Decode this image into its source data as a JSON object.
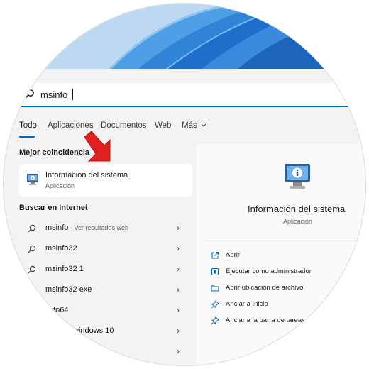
{
  "search": {
    "value": "msinfo"
  },
  "tabs": [
    {
      "label": "Todo"
    },
    {
      "label": "Aplicaciones"
    },
    {
      "label": "Documentos"
    },
    {
      "label": "Web"
    },
    {
      "label": "Más"
    }
  ],
  "best_match": {
    "heading": "Mejor coincidencia",
    "name": "Información del sistema",
    "type": "Aplicación"
  },
  "web_search": {
    "heading": "Buscar en Internet",
    "items": [
      {
        "label": "msinfo",
        "sub": " - Ver resultados web"
      },
      {
        "label": "msinfo32",
        "sub": ""
      },
      {
        "label": "msinfo32 1",
        "sub": ""
      },
      {
        "label": "msinfo32 exe",
        "sub": ""
      },
      {
        "label": "nfo64",
        "sub": ""
      },
      {
        "label": "windows 10",
        "sub": ""
      }
    ]
  },
  "preview": {
    "name": "Información del sistema",
    "type": "Aplicación",
    "actions": [
      {
        "label": "Abrir",
        "icon": "open-icon"
      },
      {
        "label": "Ejecutar como administrador",
        "icon": "admin-icon"
      },
      {
        "label": "Abrir ubicación de archivo",
        "icon": "folder-icon"
      },
      {
        "label": "Anclar a Inicio",
        "icon": "pin-icon"
      },
      {
        "label": "Anclar a la barra de tareas",
        "icon": "pin-icon"
      }
    ]
  },
  "colors": {
    "accent": "#0067c0",
    "arrow": "#e02020"
  }
}
